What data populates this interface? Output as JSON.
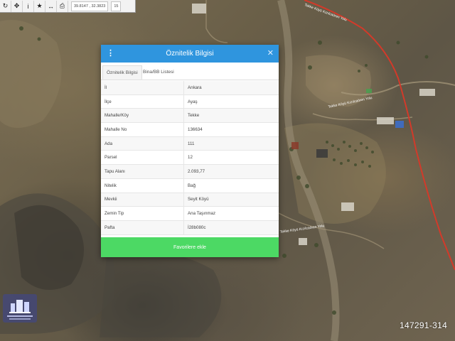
{
  "toolbar": {
    "buttons": [
      "refresh-icon",
      "locate-icon",
      "info-icon",
      "star-icon",
      "measure-icon",
      "print-icon"
    ],
    "coordinates": "39.8147 , 32.3823",
    "zoom": "15"
  },
  "map": {
    "road_color": "#d23a2a",
    "road_labels": [
      "Tekke Köyü Kızılcaören Yolu",
      "Tekke Köyü Kızılcaören Yolu",
      "Tekke Köyü Kızılcaören Yolu"
    ]
  },
  "panel": {
    "title": "Öznitelik Bilgisi",
    "header_color": "#2f95de",
    "tabs": [
      {
        "label": "Öznitelik Bilgisi",
        "active": true
      },
      {
        "label": "Bina/BB Listesi",
        "active": false
      }
    ],
    "rows": [
      {
        "key": "İl",
        "value": "Ankara"
      },
      {
        "key": "İlçe",
        "value": "Ayaş"
      },
      {
        "key": "Mahalle/Köy",
        "value": "Tekke"
      },
      {
        "key": "Mahalle No",
        "value": "136634"
      },
      {
        "key": "Ada",
        "value": "111"
      },
      {
        "key": "Parsel",
        "value": "12"
      },
      {
        "key": "Tapu Alanı",
        "value": "2.093,77"
      },
      {
        "key": "Nitelik",
        "value": "Bağ"
      },
      {
        "key": "Mevkii",
        "value": "Seyit Köyü"
      },
      {
        "key": "Zemin Tip",
        "value": "Ana Taşınmaz"
      },
      {
        "key": "Pafta",
        "value": "İ28b080c"
      }
    ],
    "favorite_button": "Favorilere ekle",
    "favorite_color": "#4cd964"
  },
  "watermark": {
    "id": "147291-314"
  }
}
